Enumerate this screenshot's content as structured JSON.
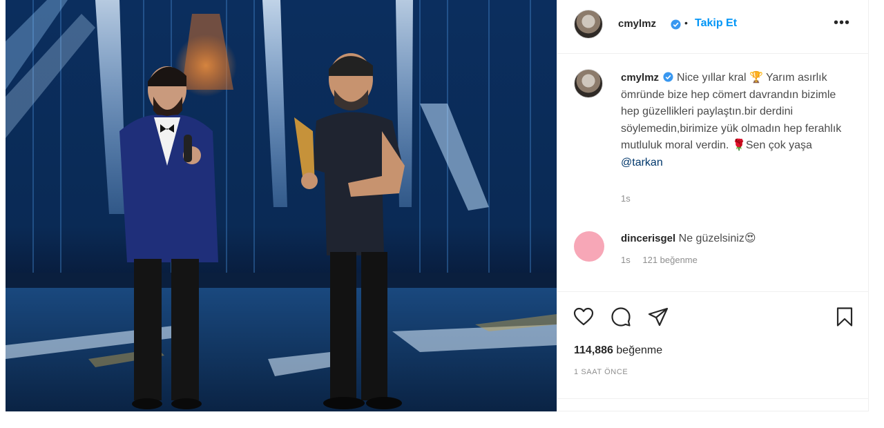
{
  "post": {
    "image_description_icon": "photo",
    "header": {
      "username": "cmylmz",
      "verified_icon": "verified-badge-icon",
      "separator": "•",
      "follow_label": "Takip Et",
      "more_label": "•••"
    },
    "caption": {
      "username": "cmylmz",
      "text_1": "Nice yıllar kral ",
      "trophy_emoji": "🏆",
      "text_2": " Yarım asırlık ömründe bize hep cömert davrandın bizimle hep güzellikleri paylaştın.bir derdini söylemedin,birimize yük olmadın hep ferahlık mutluluk moral verdin. ",
      "rose_emoji": "🌹",
      "text_3": "Sen çok yaşa ",
      "mention": "@tarkan",
      "time": "1s"
    },
    "comments": [
      {
        "username": "dincerisgel",
        "text": "Ne güzelsiniz",
        "emoji": "😍",
        "time": "1s",
        "likes": "121 beğenme"
      }
    ],
    "actions": {
      "like_icon": "heart-icon",
      "comment_icon": "comment-icon",
      "share_icon": "send-icon",
      "save_icon": "bookmark-icon"
    },
    "likes_count": "114,886",
    "likes_label": " beğenme",
    "time_ago": "1 SAAT ÖNCE"
  },
  "colors": {
    "accent": "#0095f6",
    "text": "#262626",
    "muted": "#8e8e8e",
    "mention": "#00376b",
    "commenter_avatar": "#f7a7b7"
  }
}
